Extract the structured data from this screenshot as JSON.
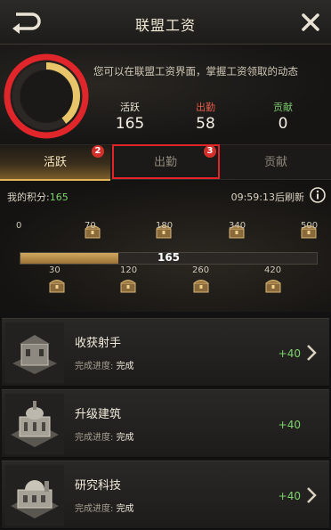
{
  "header": {
    "title": "联盟工资"
  },
  "summary": {
    "description": "您可以在联盟工资界面，掌握工资领取的动态",
    "stats": [
      {
        "label": "活跃",
        "value": "165"
      },
      {
        "label": "出勤",
        "value": "58"
      },
      {
        "label": "贡献",
        "value": "0"
      }
    ],
    "ring_progress": 0.4
  },
  "tabs": [
    {
      "label": "活跃",
      "badge": "2"
    },
    {
      "label": "出勤",
      "badge": "3"
    },
    {
      "label": "贡献"
    }
  ],
  "progress": {
    "my_score_label": "我的积分:",
    "my_score_value": "165",
    "refresh_text": "09:59:13后刷新",
    "bar_value": "165",
    "current": 165,
    "max": 500,
    "milestones_top": [
      "0",
      "70",
      "180",
      "340",
      "500"
    ],
    "milestones_bottom": [
      "30",
      "120",
      "260",
      "420"
    ]
  },
  "tasks": [
    {
      "name": "收获射手",
      "progress_label": "完成进度:",
      "status": "完成",
      "reward": "+40"
    },
    {
      "name": "升级建筑",
      "progress_label": "完成进度:",
      "status": "完成",
      "reward": "+40"
    },
    {
      "name": "研究科技",
      "progress_label": "完成进度:",
      "status": "完成",
      "reward": "+40"
    }
  ],
  "colors": {
    "accent_gold": "#d1a860",
    "highlight_red": "#e0242a",
    "positive_green": "#7ed36b",
    "attend_red": "#e25a4a"
  }
}
